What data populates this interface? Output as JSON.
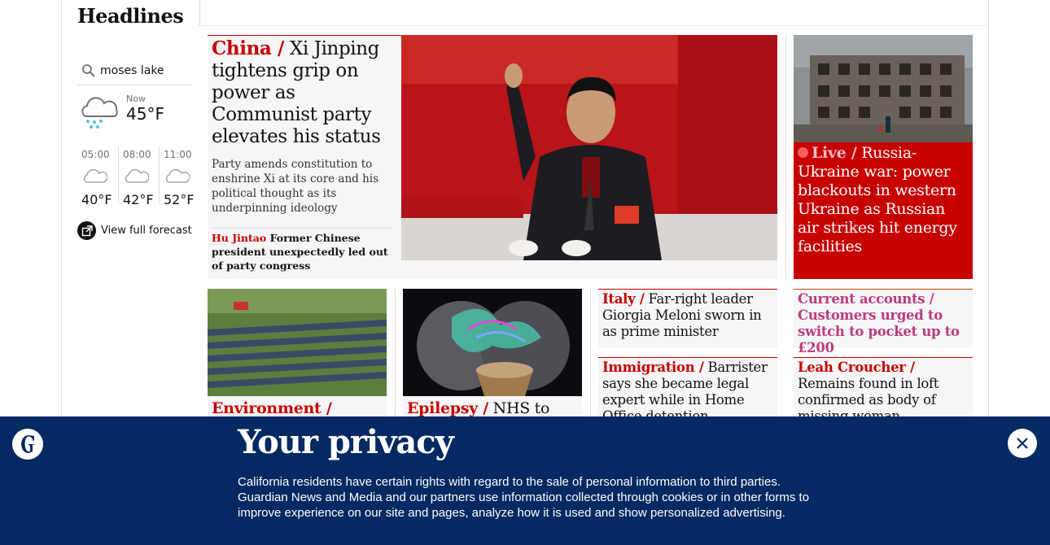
{
  "sidebar": {
    "section_title": "Headlines",
    "weather": {
      "search_value": "moses lake",
      "now_label": "Now",
      "now_temp": "45°F",
      "now_icon": "cloud-sleet-icon",
      "forecast": [
        {
          "time": "05:00",
          "temp": "40°F",
          "icon": "cloud-icon"
        },
        {
          "time": "08:00",
          "temp": "42°F",
          "icon": "cloud-icon"
        },
        {
          "time": "11:00",
          "temp": "52°F",
          "icon": "cloud-icon"
        }
      ],
      "full_forecast_label": "View full forecast"
    }
  },
  "main_story": {
    "kicker": "China /",
    "headline": " Xi Jinping tightens grip on power as Communist party elevates his status",
    "standfirst": "Party amends constitution to enshrine Xi at its core and his political thought as its underpinning ideology",
    "sublink_kicker": "Hu Jintao",
    "sublink_text": " Former Chinese president unexpectedly led out of party congress"
  },
  "live_story": {
    "kicker": "Live /",
    "headline": " Russia-Ukraine war: power blackouts in western Ukraine as Russian air strikes hit energy facilities"
  },
  "small_stories": [
    {
      "kicker": "Environment /",
      "headline": ""
    },
    {
      "kicker": "Epilepsy /",
      "headline": " NHS to offer"
    }
  ],
  "text_stories": {
    "italy": {
      "kicker": "Italy /",
      "headline": " Far-right leader Giorgia Meloni sworn in as prime minister"
    },
    "immigration": {
      "kicker": "Immigration /",
      "headline": " Barrister says she became legal expert while in Home Office detention"
    },
    "current_accounts": {
      "kicker": "Current accounts /",
      "headline": " Customers urged to switch to pocket up to £200"
    },
    "leah": {
      "kicker": "Leah Croucher /",
      "headline": " Remains found in loft confirmed as body of missing woman"
    }
  },
  "privacy_banner": {
    "title": "Your privacy",
    "body": "California residents have certain rights with regard to the sale of personal information to third parties. Guardian News and Media and our partners use information collected through cookies or in other forms to improve experience on our site and pages, analyze how it is used and show personalized advertising.",
    "close_icon": "close-icon",
    "logo": "guardian-logo"
  },
  "colors": {
    "news_red": "#c70000",
    "live_red": "#c70000",
    "lifestyle_pink": "#bb3b80",
    "banner_blue": "#052962"
  }
}
